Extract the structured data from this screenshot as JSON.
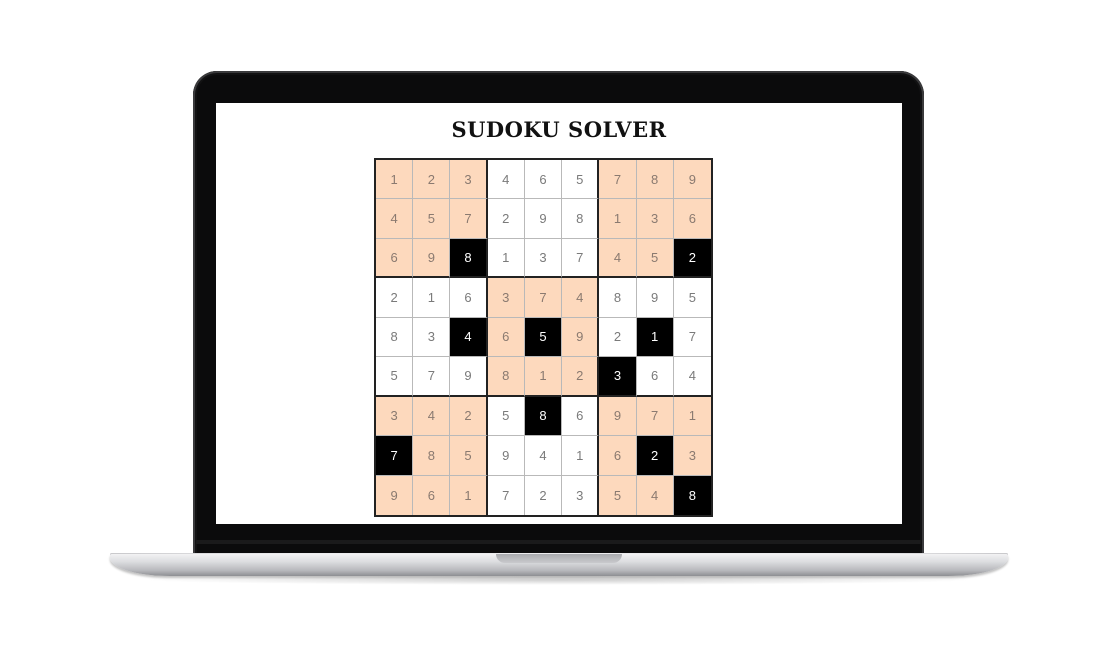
{
  "app": {
    "title": "SUDOKU SOLVER"
  },
  "colors": {
    "shaded_box": "#fdd9bd",
    "given_cell": "#000000",
    "given_text": "#ffffff",
    "solved_text": "#7a7a7a"
  },
  "grid": [
    [
      "1",
      "2",
      "3",
      "4",
      "6",
      "5",
      "7",
      "8",
      "9"
    ],
    [
      "4",
      "5",
      "7",
      "2",
      "9",
      "8",
      "1",
      "3",
      "6"
    ],
    [
      "6",
      "9",
      "8",
      "1",
      "3",
      "7",
      "4",
      "5",
      "2"
    ],
    [
      "2",
      "1",
      "6",
      "3",
      "7",
      "4",
      "8",
      "9",
      "5"
    ],
    [
      "8",
      "3",
      "4",
      "6",
      "5",
      "9",
      "2",
      "1",
      "7"
    ],
    [
      "5",
      "7",
      "9",
      "8",
      "1",
      "2",
      "3",
      "6",
      "4"
    ],
    [
      "3",
      "4",
      "2",
      "5",
      "8",
      "6",
      "9",
      "7",
      "1"
    ],
    [
      "7",
      "8",
      "5",
      "9",
      "4",
      "1",
      "6",
      "2",
      "3"
    ],
    [
      "9",
      "6",
      "1",
      "7",
      "2",
      "3",
      "5",
      "4",
      "8"
    ]
  ],
  "givens": [
    [
      2,
      2
    ],
    [
      2,
      8
    ],
    [
      4,
      2
    ],
    [
      4,
      4
    ],
    [
      4,
      7
    ],
    [
      5,
      6
    ],
    [
      6,
      4
    ],
    [
      7,
      0
    ],
    [
      7,
      7
    ],
    [
      8,
      8
    ]
  ]
}
